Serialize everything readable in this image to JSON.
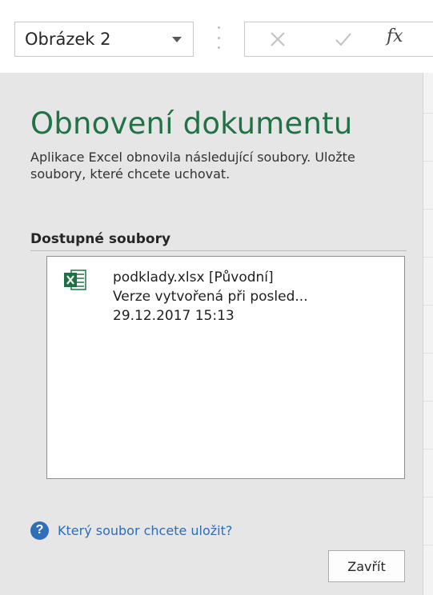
{
  "formula_bar": {
    "name_box_value": "Obrázek 2",
    "cancel_icon": "close-x-icon",
    "enter_icon": "checkmark-icon",
    "function_icon_label": "fx"
  },
  "recovery_pane": {
    "title": "Obnovení dokumentu",
    "description": "Aplikace Excel obnovila následující soubory. Uložte soubory, které chcete uchovat.",
    "available_files_label": "Dostupné soubory",
    "files": [
      {
        "icon": "excel-file-icon",
        "name_line": "podklady.xlsx  [Původní]",
        "version_line": "Verze vytvořená při posled...",
        "timestamp": "29.12.2017 15:13"
      }
    ],
    "help_link": "Který soubor chcete uložit?",
    "close_button": "Zavřít"
  },
  "colors": {
    "title_green": "#217346",
    "link_blue": "#2e6db4",
    "pane_background": "#e6e6e6"
  }
}
